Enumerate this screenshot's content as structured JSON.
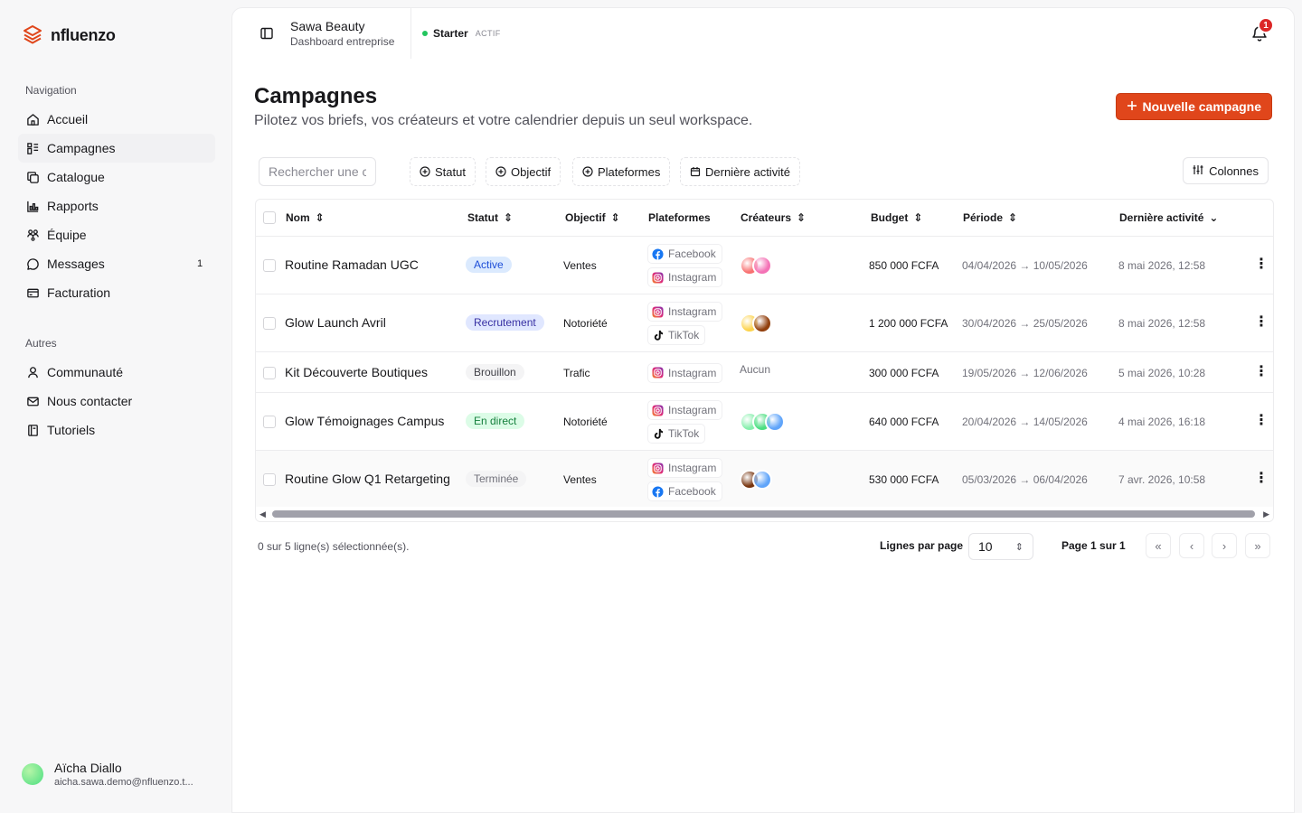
{
  "brand": {
    "name": "nfluenzo",
    "color": "#e0461b"
  },
  "sidebar": {
    "nav_label": "Navigation",
    "nav_items": [
      {
        "label": "Accueil",
        "icon": "home-icon"
      },
      {
        "label": "Campagnes",
        "icon": "kanban-icon",
        "active": true
      },
      {
        "label": "Catalogue",
        "icon": "copy-icon"
      },
      {
        "label": "Rapports",
        "icon": "chart-icon"
      },
      {
        "label": "Équipe",
        "icon": "team-icon"
      },
      {
        "label": "Messages",
        "icon": "message-icon",
        "count": "1"
      },
      {
        "label": "Facturation",
        "icon": "card-icon"
      }
    ],
    "other_label": "Autres",
    "other_items": [
      {
        "label": "Communauté",
        "icon": "user-icon"
      },
      {
        "label": "Nous contacter",
        "icon": "mail-icon"
      },
      {
        "label": "Tutoriels",
        "icon": "book-icon"
      }
    ],
    "user": {
      "name": "Aïcha Diallo",
      "email": "aicha.sawa.demo@nfluenzo.t..."
    }
  },
  "topbar": {
    "org_name": "Sawa Beauty",
    "org_sub": "Dashboard entreprise",
    "plan_name": "Starter",
    "plan_status": "ACTIF",
    "notifications": "1"
  },
  "page": {
    "title": "Campagnes",
    "subtitle": "Pilotez vos briefs, vos créateurs et votre calendrier depuis un seul workspace.",
    "new_button": "Nouvelle campagne"
  },
  "toolbar": {
    "search_placeholder": "Rechercher une campagne...",
    "filters": [
      "Statut",
      "Objectif",
      "Plateformes",
      "Dernière activité"
    ],
    "columns_button": "Colonnes"
  },
  "table": {
    "headers": {
      "name": "Nom",
      "status": "Statut",
      "objective": "Objectif",
      "platforms": "Plateformes",
      "creators": "Créateurs",
      "budget": "Budget",
      "period": "Période",
      "last_activity": "Dernière activité"
    },
    "rows": [
      {
        "name": "Routine Ramadan UGC",
        "status": "Active",
        "status_bg": "#dbeafe",
        "status_fg": "#1d4ed8",
        "objective": "Ventes",
        "platforms": [
          "Facebook",
          "Instagram"
        ],
        "creators": [
          "#f87171",
          "#f472b6"
        ],
        "budget": "850 000 FCFA",
        "period": "04/04/2026 → 10/05/2026",
        "last_activity": "8 mai 2026, 12:58"
      },
      {
        "name": "Glow Launch Avril",
        "status": "Recrutement",
        "status_bg": "#e0e7ff",
        "status_fg": "#3730a3",
        "objective": "Notoriété",
        "platforms": [
          "Instagram",
          "TikTok"
        ],
        "creators": [
          "#fcd34d",
          "#92400e"
        ],
        "budget": "1 200 000 FCFA",
        "period": "30/04/2026 → 25/05/2026",
        "last_activity": "8 mai 2026, 12:58"
      },
      {
        "name": "Kit Découverte Boutiques",
        "status": "Brouillon",
        "status_bg": "#f4f4f5",
        "status_fg": "#3f3f46",
        "objective": "Trafic",
        "platforms": [
          "Instagram"
        ],
        "creators": [],
        "creators_empty": "Aucun",
        "budget": "300 000 FCFA",
        "period": "19/05/2026 → 12/06/2026",
        "last_activity": "5 mai 2026, 10:28"
      },
      {
        "name": "Glow Témoignages Campus",
        "status": "En direct",
        "status_bg": "#dcfce7",
        "status_fg": "#15803d",
        "objective": "Notoriété",
        "platforms": [
          "Instagram",
          "TikTok"
        ],
        "creators": [
          "#86efac",
          "#4ade80",
          "#60a5fa"
        ],
        "budget": "640 000 FCFA",
        "period": "20/04/2026 → 14/05/2026",
        "last_activity": "4 mai 2026, 16:18"
      },
      {
        "name": "Routine Glow Q1 Retargeting",
        "status": "Terminée",
        "status_bg": "#f4f4f5",
        "status_fg": "#71717a",
        "objective": "Ventes",
        "platforms": [
          "Instagram",
          "Facebook"
        ],
        "creators": [
          "#78350f",
          "#60a5fa"
        ],
        "budget": "530 000 FCFA",
        "period": "05/03/2026 → 06/04/2026",
        "last_activity": "7 avr. 2026, 10:58"
      }
    ]
  },
  "footer": {
    "selection": "0 sur 5 ligne(s) sélectionnée(s).",
    "rows_per_page_label": "Lignes par page",
    "rows_per_page": "10",
    "page_label": "Page 1 sur 1"
  }
}
